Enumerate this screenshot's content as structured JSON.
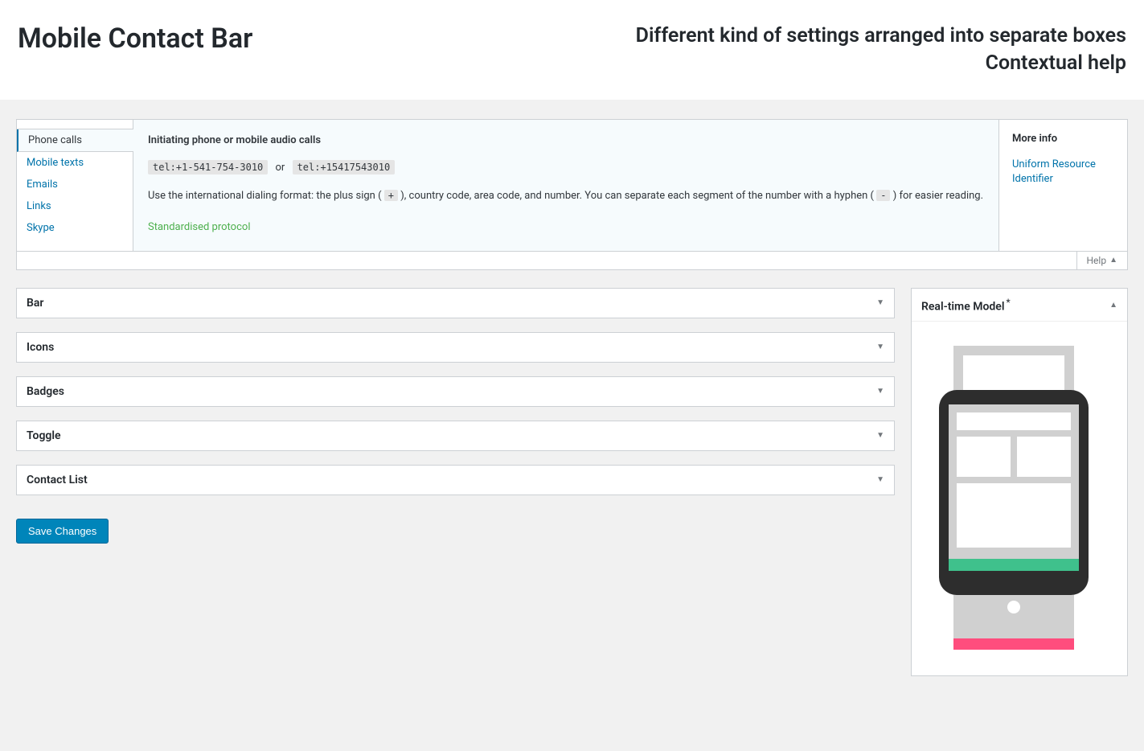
{
  "header": {
    "title": "Mobile Contact Bar",
    "tagline_line1": "Different kind of settings arranged into separate boxes",
    "tagline_line2": "Contextual help"
  },
  "helpPanel": {
    "tabs": [
      {
        "id": "phone-calls",
        "label": "Phone calls",
        "active": true
      },
      {
        "id": "mobile-texts",
        "label": "Mobile texts",
        "active": false
      },
      {
        "id": "emails",
        "label": "Emails",
        "active": false
      },
      {
        "id": "links",
        "label": "Links",
        "active": false
      },
      {
        "id": "skype",
        "label": "Skype",
        "active": false
      }
    ],
    "content": {
      "heading": "Initiating phone or mobile audio calls",
      "code1": "tel:+1-541-754-3010",
      "or": "or",
      "code2": "tel:+15417543010",
      "instruction_pre": "Use the international dialing format: the plus sign (",
      "key_plus": "+",
      "instruction_mid": "), country code, area code, and number. You can separate each segment of the number with a hyphen (",
      "key_dash": "-",
      "instruction_post": ") for easier reading.",
      "protocol_link": "Standardised protocol"
    },
    "sidebar": {
      "title": "More info",
      "link": "Uniform Resource Identifier"
    },
    "toggle_label": "Help"
  },
  "metaboxes": [
    {
      "id": "bar",
      "title": "Bar"
    },
    {
      "id": "icons",
      "title": "Icons"
    },
    {
      "id": "badges",
      "title": "Badges"
    },
    {
      "id": "toggle",
      "title": "Toggle"
    },
    {
      "id": "contact-list",
      "title": "Contact List"
    }
  ],
  "save_button": "Save Changes",
  "modelPanel": {
    "title": "Real-time Model",
    "asterisk": "*"
  }
}
